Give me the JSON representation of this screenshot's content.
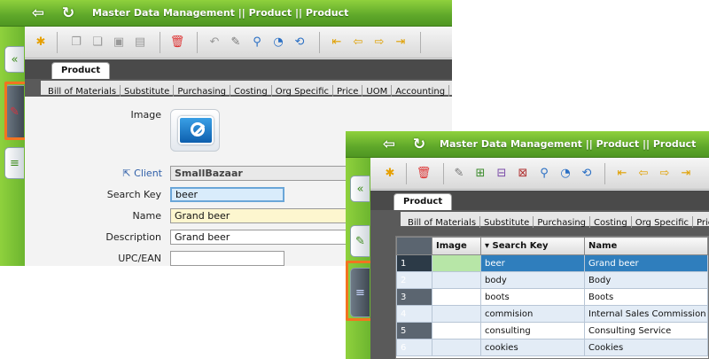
{
  "window_back": {
    "title": "Master Data Management || Product  ||  Product",
    "tab": "Product",
    "subtabs": [
      "Bill of Materials",
      "Substitute",
      "Purchasing",
      "Costing",
      "Org Specific",
      "Price",
      "UOM",
      "Accounting"
    ],
    "form": {
      "image_label": "Image",
      "client_label": "Client",
      "client_value": "SmallBazaar",
      "search_key_label": "Search Key",
      "search_key_value": "beer",
      "name_label": "Name",
      "name_value": "Grand beer",
      "description_label": "Description",
      "description_value": "Grand beer",
      "upc_label": "UPC/EAN",
      "upc_value": ""
    }
  },
  "window_front": {
    "title": "Master Data Management || Product  ||  Product",
    "tab": "Product",
    "subtabs": [
      "Bill of Materials",
      "Substitute",
      "Purchasing",
      "Costing",
      "Org Specific",
      "Price"
    ],
    "grid": {
      "columns": [
        "Image",
        "▾ Search Key",
        "Name"
      ],
      "rows": [
        {
          "n": "1",
          "key": "beer",
          "name": "Grand beer"
        },
        {
          "n": "2",
          "key": "body",
          "name": "Body"
        },
        {
          "n": "3",
          "key": "boots",
          "name": "Boots"
        },
        {
          "n": "4",
          "key": "commision",
          "name": "Internal Sales Commission"
        },
        {
          "n": "5",
          "key": "consulting",
          "name": "Consulting Service"
        },
        {
          "n": "6",
          "key": "cookies",
          "name": "Cookies"
        }
      ]
    }
  },
  "icons": {
    "back": "⇦",
    "refresh": "↻",
    "collapse": "«",
    "pencil": "✎",
    "grid": "≡"
  },
  "colors": {
    "title_green": "#5fa82a",
    "highlight_orange": "#f27420",
    "selected_row": "#2f7ebd"
  }
}
